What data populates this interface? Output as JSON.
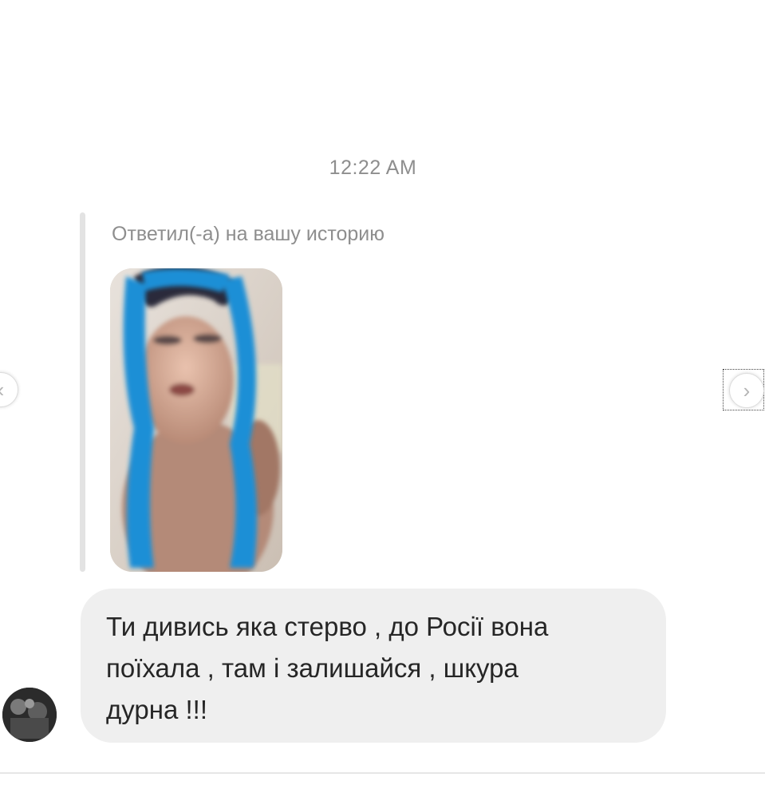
{
  "chat": {
    "timestamp": "12:22 AM",
    "story_reply": {
      "label": "Ответил(-а) на вашу историю",
      "thumbnail_description": "story-photo"
    },
    "message": {
      "text": "Ти дивись яка стерво , до Росії вона\nпоїхала , там і залишайся , шкура\nдурна !!!"
    }
  },
  "navigation": {
    "prev_icon": "chevron-left-icon",
    "next_icon": "chevron-right-icon"
  },
  "colors": {
    "bubble_background": "#efefef",
    "meta_text": "#8e8e8e",
    "message_text": "#262626",
    "hair_accent": "#1e8fd6"
  }
}
